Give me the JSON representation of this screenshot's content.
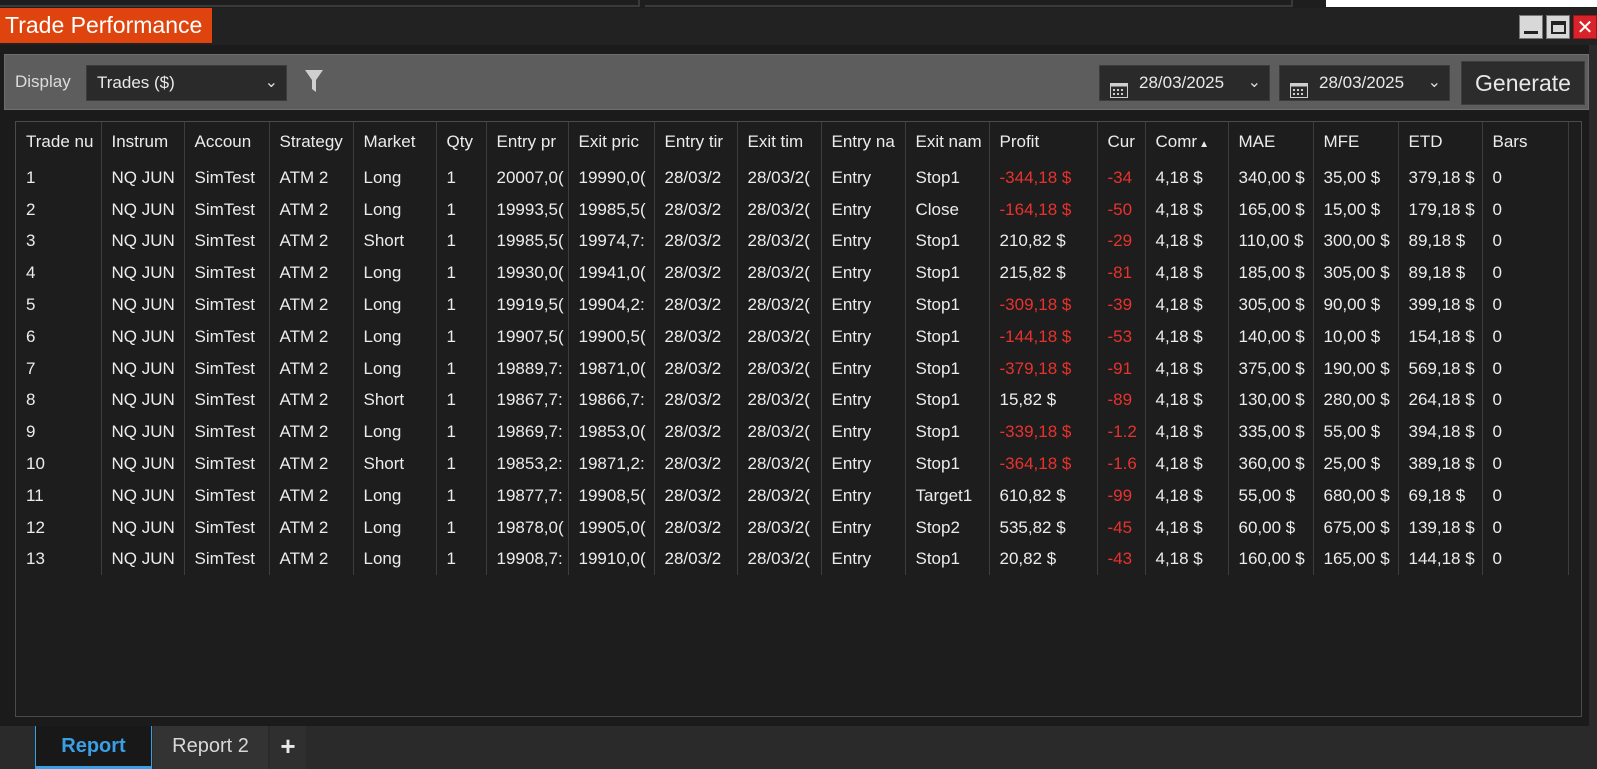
{
  "window": {
    "title": "Trade Performance"
  },
  "toolbar": {
    "display_label": "Display",
    "display_value": "Trades ($)",
    "date_from": "28/03/2025",
    "date_to": "28/03/2025",
    "generate_label": "Generate"
  },
  "table": {
    "columns": [
      "Trade nu",
      "Instrum",
      "Accoun",
      "Strategy",
      "Market",
      "Qty",
      "Entry pr",
      "Exit pric",
      "Entry tir",
      "Exit tim",
      "Entry na",
      "Exit nam",
      "Profit",
      "Cur",
      "Comr",
      "MAE",
      "MFE",
      "ETD",
      "Bars"
    ],
    "rows": [
      [
        "1",
        "NQ JUN",
        "SimTest",
        "ATM 2",
        "Long",
        "1",
        "20007,0(",
        "19990,0(",
        "28/03/2",
        "28/03/2(",
        "Entry",
        "Stop1",
        "-344,18 $",
        "-34",
        "4,18 $",
        "340,00 $",
        "35,00 $",
        "379,18 $",
        "0"
      ],
      [
        "2",
        "NQ JUN",
        "SimTest",
        "ATM 2",
        "Long",
        "1",
        "19993,5(",
        "19985,5(",
        "28/03/2",
        "28/03/2(",
        "Entry",
        "Close",
        "-164,18 $",
        "-50",
        "4,18 $",
        "165,00 $",
        "15,00 $",
        "179,18 $",
        "0"
      ],
      [
        "3",
        "NQ JUN",
        "SimTest",
        "ATM 2",
        "Short",
        "1",
        "19985,5(",
        "19974,7:",
        "28/03/2",
        "28/03/2(",
        "Entry",
        "Stop1",
        "210,82 $",
        "-29",
        "4,18 $",
        "110,00 $",
        "300,00 $",
        "89,18 $",
        "0"
      ],
      [
        "4",
        "NQ JUN",
        "SimTest",
        "ATM 2",
        "Long",
        "1",
        "19930,0(",
        "19941,0(",
        "28/03/2",
        "28/03/2(",
        "Entry",
        "Stop1",
        "215,82 $",
        "-81",
        "4,18 $",
        "185,00 $",
        "305,00 $",
        "89,18 $",
        "0"
      ],
      [
        "5",
        "NQ JUN",
        "SimTest",
        "ATM 2",
        "Long",
        "1",
        "19919,5(",
        "19904,2:",
        "28/03/2",
        "28/03/2(",
        "Entry",
        "Stop1",
        "-309,18 $",
        "-39",
        "4,18 $",
        "305,00 $",
        "90,00 $",
        "399,18 $",
        "0"
      ],
      [
        "6",
        "NQ JUN",
        "SimTest",
        "ATM 2",
        "Long",
        "1",
        "19907,5(",
        "19900,5(",
        "28/03/2",
        "28/03/2(",
        "Entry",
        "Stop1",
        "-144,18 $",
        "-53",
        "4,18 $",
        "140,00 $",
        "10,00 $",
        "154,18 $",
        "0"
      ],
      [
        "7",
        "NQ JUN",
        "SimTest",
        "ATM 2",
        "Long",
        "1",
        "19889,7:",
        "19871,0(",
        "28/03/2",
        "28/03/2(",
        "Entry",
        "Stop1",
        "-379,18 $",
        "-91",
        "4,18 $",
        "375,00 $",
        "190,00 $",
        "569,18 $",
        "0"
      ],
      [
        "8",
        "NQ JUN",
        "SimTest",
        "ATM 2",
        "Short",
        "1",
        "19867,7:",
        "19866,7:",
        "28/03/2",
        "28/03/2(",
        "Entry",
        "Stop1",
        "15,82 $",
        "-89",
        "4,18 $",
        "130,00 $",
        "280,00 $",
        "264,18 $",
        "0"
      ],
      [
        "9",
        "NQ JUN",
        "SimTest",
        "ATM 2",
        "Long",
        "1",
        "19869,7:",
        "19853,0(",
        "28/03/2",
        "28/03/2(",
        "Entry",
        "Stop1",
        "-339,18 $",
        "-1.2",
        "4,18 $",
        "335,00 $",
        "55,00 $",
        "394,18 $",
        "0"
      ],
      [
        "10",
        "NQ JUN",
        "SimTest",
        "ATM 2",
        "Short",
        "1",
        "19853,2:",
        "19871,2:",
        "28/03/2",
        "28/03/2(",
        "Entry",
        "Stop1",
        "-364,18 $",
        "-1.6",
        "4,18 $",
        "360,00 $",
        "25,00 $",
        "389,18 $",
        "0"
      ],
      [
        "11",
        "NQ JUN",
        "SimTest",
        "ATM 2",
        "Long",
        "1",
        "19877,7:",
        "19908,5(",
        "28/03/2",
        "28/03/2(",
        "Entry",
        "Target1",
        "610,82 $",
        "-99",
        "4,18 $",
        "55,00 $",
        "680,00 $",
        "69,18 $",
        "0"
      ],
      [
        "12",
        "NQ JUN",
        "SimTest",
        "ATM 2",
        "Long",
        "1",
        "19878,0(",
        "19905,0(",
        "28/03/2",
        "28/03/2(",
        "Entry",
        "Stop2",
        "535,82 $",
        "-45",
        "4,18 $",
        "60,00 $",
        "675,00 $",
        "139,18 $",
        "0"
      ],
      [
        "13",
        "NQ JUN",
        "SimTest",
        "ATM 2",
        "Long",
        "1",
        "19908,7:",
        "19910,0(",
        "28/03/2",
        "28/03/2(",
        "Entry",
        "Stop1",
        "20,82 $",
        "-43",
        "4,18 $",
        "160,00 $",
        "165,00 $",
        "144,18 $",
        "0"
      ]
    ]
  },
  "tabs": [
    {
      "label": "Report",
      "active": true
    },
    {
      "label": "Report 2",
      "active": false
    }
  ],
  "add_tab_label": "+",
  "colors": {
    "accent": "#e0440e",
    "negative": "#e8322e",
    "active_tab": "#3a9fe5"
  },
  "icons": {
    "filter": "filter-icon",
    "calendar": "calendar-icon",
    "dropdown": "chevron-down-icon"
  }
}
